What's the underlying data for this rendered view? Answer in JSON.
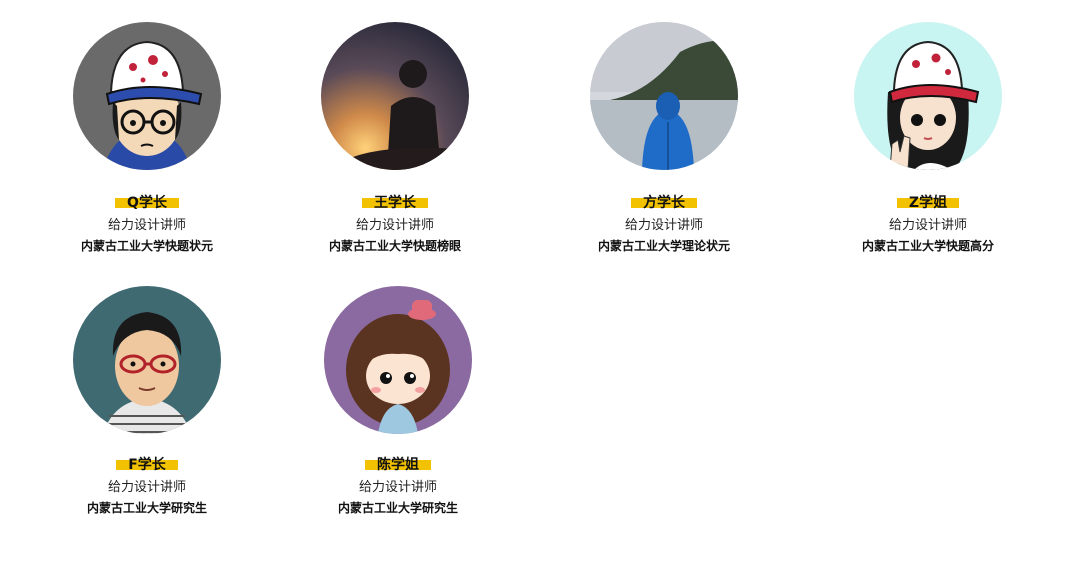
{
  "mentors": [
    {
      "name": "Q学长",
      "title": "给力设计讲师",
      "desc": "内蒙古工业大学快题状元",
      "avatar": "cap-boy-avatar"
    },
    {
      "name": "王学长",
      "title": "给力设计讲师",
      "desc": "内蒙古工业大学快题榜眼",
      "avatar": "sunset-silhouette-avatar"
    },
    {
      "name": "方学长",
      "title": "给力设计讲师",
      "desc": "内蒙古工业大学理论状元",
      "avatar": "lake-hoodie-avatar"
    },
    {
      "name": "Z学姐",
      "title": "给力设计讲师",
      "desc": "内蒙古工业大学快题高分",
      "avatar": "cap-girl-avatar"
    },
    {
      "name": "F学长",
      "title": "给力设计讲师",
      "desc": "内蒙古工业大学研究生",
      "avatar": "glasses-man-avatar"
    },
    {
      "name": "陈学姐",
      "title": "给力设计讲师",
      "desc": "内蒙古工业大学研究生",
      "avatar": "cartoon-girl-avatar"
    }
  ],
  "colors": {
    "highlight": "#f2c100",
    "text": "#111111"
  }
}
